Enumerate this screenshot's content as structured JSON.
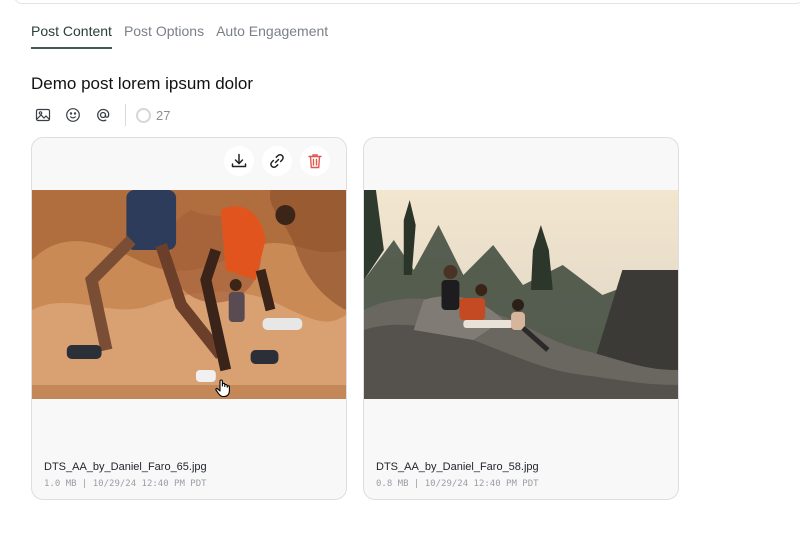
{
  "tabs": [
    {
      "label": "Post Content",
      "active": true
    },
    {
      "label": "Post Options",
      "active": false
    },
    {
      "label": "Auto Engagement",
      "active": false
    }
  ],
  "post": {
    "title": "Demo post lorem ipsum dolor",
    "char_count": "27"
  },
  "toolbar": {
    "icons": [
      "image-icon",
      "emoji-icon",
      "mention-icon"
    ]
  },
  "media": [
    {
      "filename": "DTS_AA_by_Daniel_Faro_65.jpg",
      "meta": "1.0 MB | 10/29/24 12:40 PM PDT",
      "actions": [
        "download-icon",
        "link-icon",
        "trash-icon"
      ]
    },
    {
      "filename": "DTS_AA_by_Daniel_Faro_58.jpg",
      "meta": "0.8 MB | 10/29/24 12:40 PM PDT"
    }
  ],
  "colors": {
    "accent": "#3f5a52",
    "danger": "#e0584f",
    "card_bg": "#f8f8f9",
    "border": "#dcdee2"
  }
}
